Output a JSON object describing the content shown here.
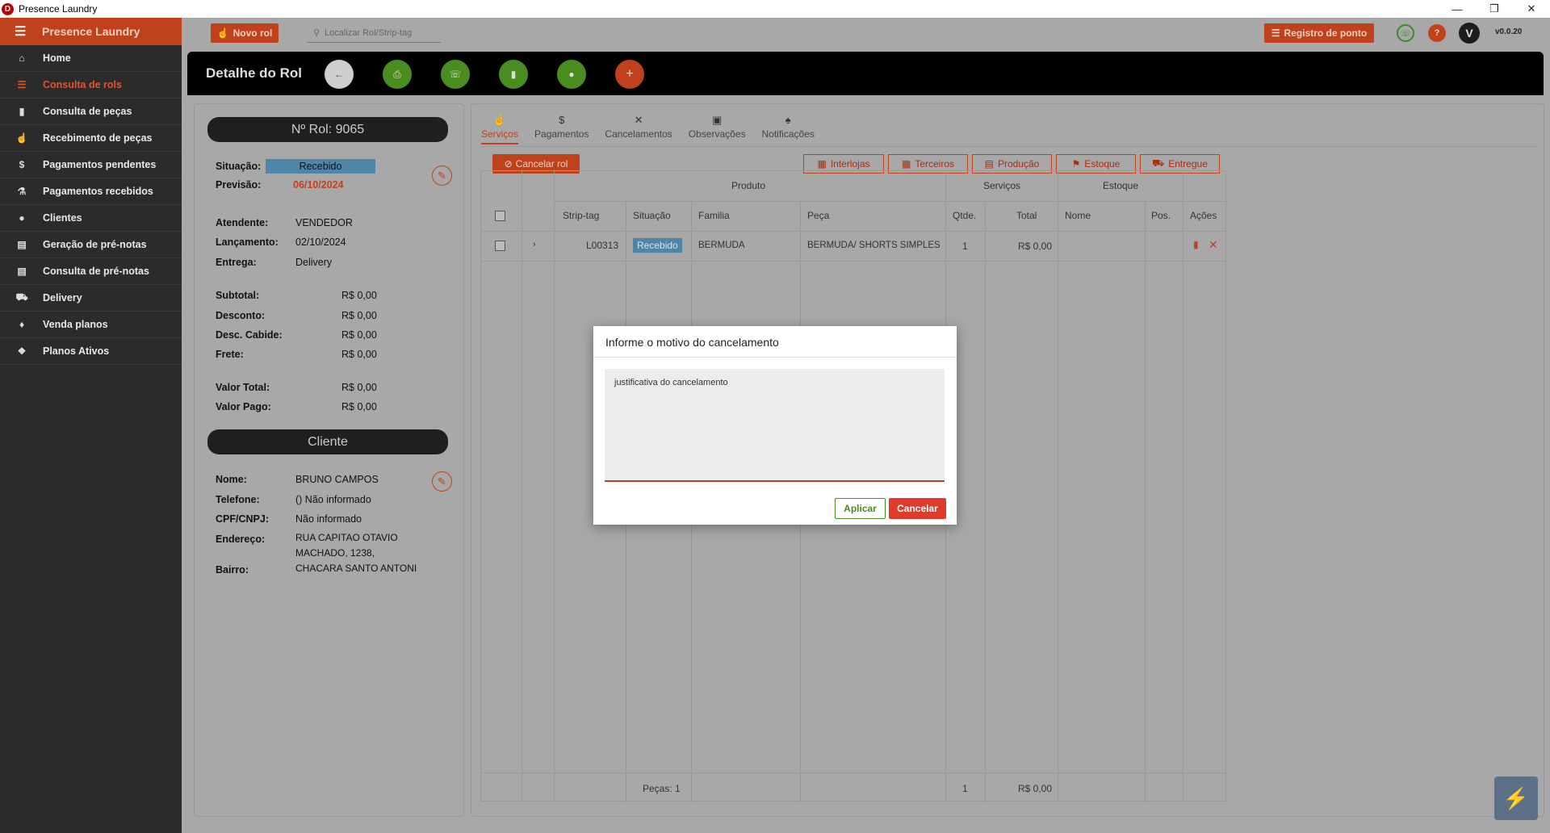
{
  "window": {
    "title": "Presence Laundry",
    "app_icon": "D",
    "controls": [
      "minimize-icon",
      "maximize-icon",
      "close-icon"
    ]
  },
  "sidebar": {
    "brand": "Presence Laundry",
    "items": [
      {
        "label": "Home",
        "icon": "home-icon"
      },
      {
        "label": "Consulta de rols",
        "icon": "list-filter-icon",
        "active": true
      },
      {
        "label": "Consulta de peças",
        "icon": "tag-icon"
      },
      {
        "label": "Recebimento de peças",
        "icon": "cart-icon"
      },
      {
        "label": "Pagamentos pendentes",
        "icon": "dollar-icon"
      },
      {
        "label": "Pagamentos recebidos",
        "icon": "receipt-icon"
      },
      {
        "label": "Clientes",
        "icon": "person-icon"
      },
      {
        "label": "Geração de pré-notas",
        "icon": "doc-icon"
      },
      {
        "label": "Consulta de pré-notas",
        "icon": "doc-search-icon"
      },
      {
        "label": "Delivery",
        "icon": "truck-icon"
      },
      {
        "label": "Venda planos",
        "icon": "plan-icon"
      },
      {
        "label": "Planos Ativos",
        "icon": "layers-icon"
      }
    ]
  },
  "topbar": {
    "new_button": "Novo rol",
    "search_placeholder": "Localizar Rol/Strip-tag",
    "clock_button": "Registro de ponto",
    "avatar": "V",
    "version": "v0.0.20"
  },
  "header": {
    "title": "Detalhe do Rol",
    "buttons": [
      "back-icon",
      "print-icon",
      "whatsapp-icon",
      "tag-icon",
      "person-icon",
      "add-icon"
    ]
  },
  "rol": {
    "number_label": "Nº Rol: 9065",
    "situacao_label": "Situação:",
    "situacao": "Recebido",
    "previsao_label": "Previsão:",
    "previsao": "06/10/2024",
    "atendente_label": "Atendente:",
    "atendente": "VENDEDOR",
    "lancamento_label": "Lançamento:",
    "lancamento": "02/10/2024",
    "entrega_label": "Entrega:",
    "entrega": "Delivery",
    "subtotal_label": "Subtotal:",
    "subtotal": "R$ 0,00",
    "desconto_label": "Desconto:",
    "desconto": "R$ 0,00",
    "desc_cabide_label": "Desc. Cabide:",
    "desc_cabide": "R$ 0,00",
    "frete_label": "Frete:",
    "frete": "R$ 0,00",
    "valor_total_label": "Valor Total:",
    "valor_total": "R$ 0,00",
    "valor_pago_label": "Valor Pago:",
    "valor_pago": "R$ 0,00"
  },
  "cliente": {
    "title": "Cliente",
    "nome_label": "Nome:",
    "nome": "BRUNO CAMPOS",
    "telefone_label": "Telefone:",
    "telefone": "() Não informado",
    "cpf_label": "CPF/CNPJ:",
    "cpf": "Não informado",
    "endereco_label": "Endereço:",
    "endereco_1": "RUA CAPITAO OTAVIO",
    "endereco_2": "MACHADO, 1238,",
    "bairro_label": "Bairro:",
    "bairro": "CHACARA SANTO ANTONI"
  },
  "tabs": [
    {
      "label": "Serviços",
      "icon": "cart-icon",
      "active": true
    },
    {
      "label": "Pagamentos",
      "icon": "dollar-icon"
    },
    {
      "label": "Cancelamentos",
      "icon": "close-icon"
    },
    {
      "label": "Observações",
      "icon": "comment-icon"
    },
    {
      "label": "Notificações",
      "icon": "bell-icon"
    }
  ],
  "actions": {
    "cancel_rol": "Cancelar rol",
    "interlojas": "Interlojas",
    "terceiros": "Terceiros",
    "producao": "Produção",
    "estoque": "Estoque",
    "entregue": "Entregue"
  },
  "grid": {
    "groups": {
      "produto": "Produto",
      "servicos": "Serviços",
      "estoque": "Estoque"
    },
    "columns": {
      "strip_tag": "Strip-tag",
      "situacao": "Situação",
      "familia": "Familia",
      "peca": "Peça",
      "qtde": "Qtde.",
      "total": "Total",
      "nome": "Nome",
      "pos": "Pos.",
      "acoes": "Ações"
    },
    "rows": [
      {
        "strip_tag": "L00313",
        "situacao": "Recebido",
        "familia": "BERMUDA",
        "peca": "BERMUDA/ SHORTS SIMPLES",
        "qtde": "1",
        "total": "R$ 0,00",
        "nome": "",
        "pos": ""
      }
    ],
    "footer": {
      "pecas": "Peças: 1",
      "qtde": "1",
      "total": "R$ 0,00"
    }
  },
  "dialog": {
    "title": "Informe o motivo do cancelamento",
    "text": "justificativa do cancelamento",
    "apply": "Aplicar",
    "cancel": "Cancelar"
  },
  "colors": {
    "accent": "#c0421c",
    "badge": "#4f86a8",
    "green": "#4a8d1f",
    "sidebar": "#2b2b2b"
  }
}
